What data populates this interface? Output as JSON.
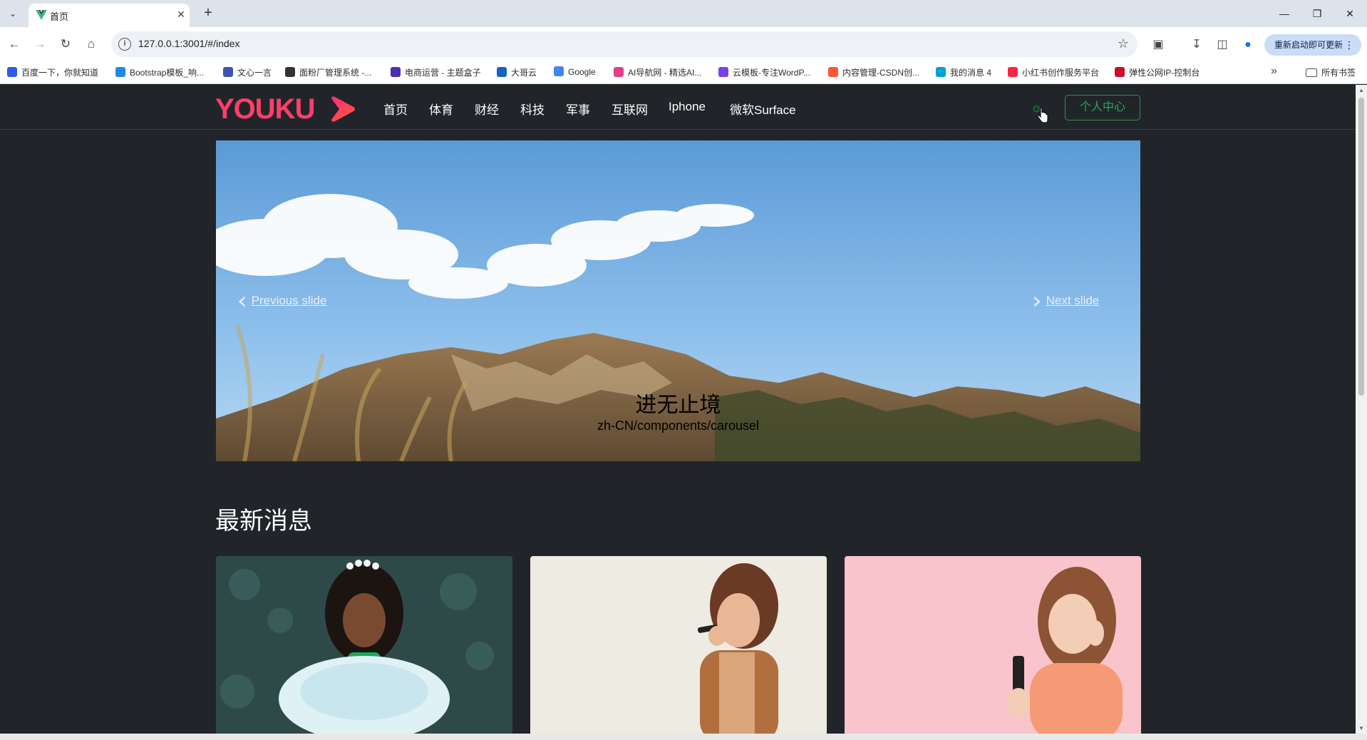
{
  "browser": {
    "tab_title": "首页",
    "url": "127.0.0.1:3001/#/index",
    "update_label": "重新启动即可更新",
    "bookmarks": [
      {
        "label": "百度一下，你就知道",
        "color": "#2f5bea"
      },
      {
        "label": "Bootstrap模板_响...",
        "color": "#1e88e5"
      },
      {
        "label": "文心一言",
        "color": "#3f51b5"
      },
      {
        "label": "面粉厂管理系统 -...",
        "color": "#333333"
      },
      {
        "label": "电商运营 - 主题盒子",
        "color": "#4a2fb5"
      },
      {
        "label": "大哥云",
        "color": "#1565c0"
      },
      {
        "label": "Google",
        "color": "#4285f4"
      },
      {
        "label": "AI导航网 - 精选AI...",
        "color": "#e0408a"
      },
      {
        "label": "云模板-专注WordP...",
        "color": "#7b3fe4"
      },
      {
        "label": "内容管理-CSDN创...",
        "color": "#fc5531"
      },
      {
        "label": "我的消息 4",
        "color": "#00a1d6"
      },
      {
        "label": "小红书创作服务平台",
        "color": "#ff2442"
      },
      {
        "label": "弹性公网IP-控制台",
        "color": "#cf0a2c"
      }
    ],
    "all_bookmarks_label": "所有书签"
  },
  "site": {
    "logo_text": "YOUKU",
    "nav_items": [
      "首页",
      "体育",
      "财经",
      "科技",
      "军事",
      "互联网",
      "Iphone",
      "微软Surface"
    ],
    "profile_button": "个人中心",
    "accent_color": "#ff3e6c",
    "success_color": "#2aa35f"
  },
  "carousel": {
    "prev_label": "Previous slide",
    "next_label": "Next slide",
    "caption_title": "进无止境",
    "caption_subtitle": "zh-CN/components/carousel"
  },
  "news": {
    "section_title": "最新消息"
  }
}
